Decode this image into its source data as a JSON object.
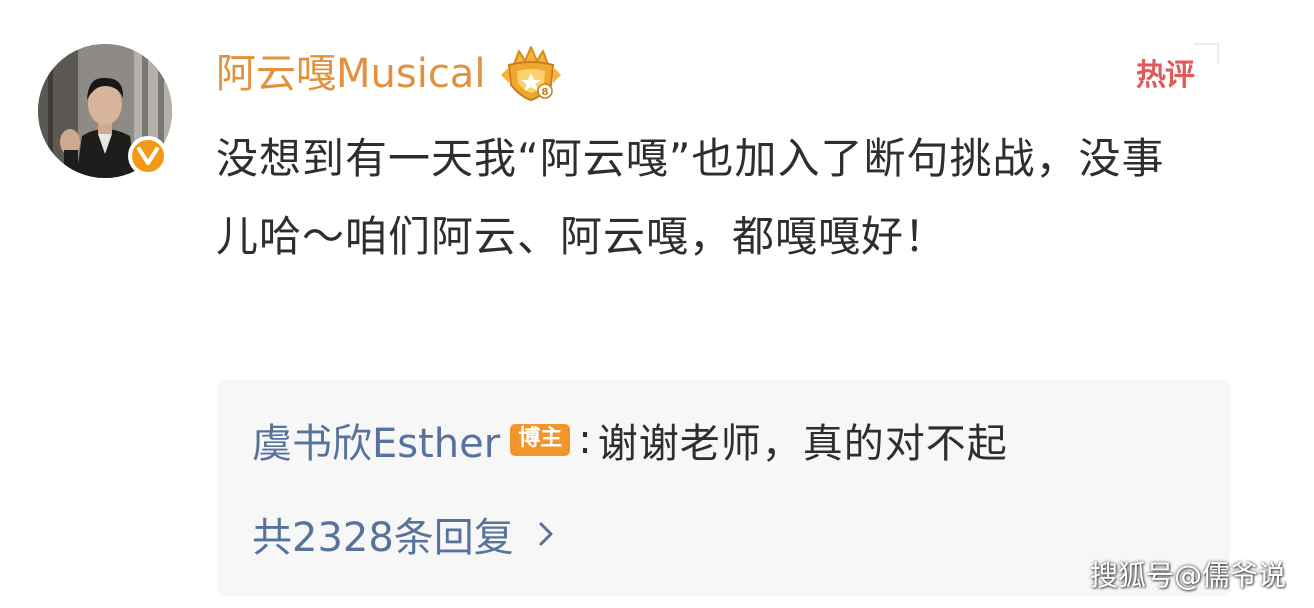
{
  "post": {
    "username": "阿云嘎Musical",
    "hot_badge": "热评",
    "comment_text": "没想到有一天我“阿云嘎”也加入了断句挑战，没事儿哈～咱们阿云、阿云嘎，都嘎嘎好！"
  },
  "reply": {
    "author": "虞书欣Esther",
    "author_tag": "博主",
    "colon": ":",
    "text": "谢谢老师，真的对不起",
    "count_text": "共2328条回复"
  },
  "watermark": {
    "text": "搜狐号@儒爷说"
  },
  "icons": {
    "avatar": "user-avatar-photo",
    "verified": "verified-v-icon",
    "crown": "fan-crown-badge-icon",
    "chevron": "chevron-right-icon"
  },
  "colors": {
    "username": "#e3913c",
    "hot_badge": "#e05a5a",
    "reply_link": "#58739b",
    "blogger_tag": "#f2962c",
    "verified": "#f39a12",
    "reply_background": "#f7f7f7"
  }
}
